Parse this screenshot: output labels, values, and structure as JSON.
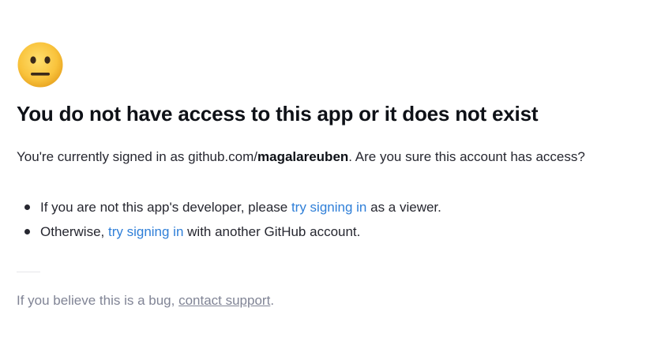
{
  "emoji": {
    "icon": "neutral-face-icon"
  },
  "title": "You do not have access to this app or it does not exist",
  "signed_in": {
    "prefix": "You're currently signed in as github.com/",
    "username": "magalareuben",
    "suffix": ". Are you sure this account has access?"
  },
  "bullets": [
    {
      "prefix": "If you are not this app's developer, please ",
      "link": "try signing in",
      "suffix": " as a viewer."
    },
    {
      "prefix": "Otherwise, ",
      "link": "try signing in",
      "suffix": " with another GitHub account."
    }
  ],
  "footer": {
    "prefix": "If you believe this is a bug, ",
    "link": "contact support",
    "suffix": "."
  },
  "colors": {
    "link": "#2f7fd8",
    "muted": "#808495",
    "text": "#262730",
    "emoji_face": "#f9c33c"
  }
}
